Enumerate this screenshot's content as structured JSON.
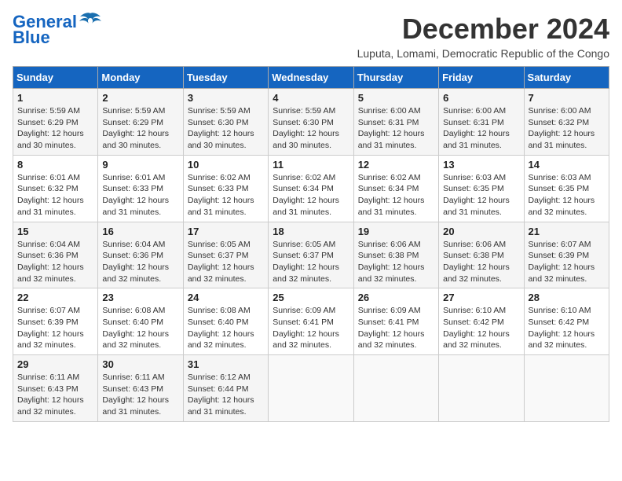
{
  "logo": {
    "line1": "General",
    "line2": "Blue"
  },
  "title": "December 2024",
  "subtitle": "Luputa, Lomami, Democratic Republic of the Congo",
  "weekdays": [
    "Sunday",
    "Monday",
    "Tuesday",
    "Wednesday",
    "Thursday",
    "Friday",
    "Saturday"
  ],
  "weeks": [
    [
      {
        "day": "1",
        "sunrise": "5:59 AM",
        "sunset": "6:29 PM",
        "daylight": "12 hours and 30 minutes."
      },
      {
        "day": "2",
        "sunrise": "5:59 AM",
        "sunset": "6:29 PM",
        "daylight": "12 hours and 30 minutes."
      },
      {
        "day": "3",
        "sunrise": "5:59 AM",
        "sunset": "6:30 PM",
        "daylight": "12 hours and 30 minutes."
      },
      {
        "day": "4",
        "sunrise": "5:59 AM",
        "sunset": "6:30 PM",
        "daylight": "12 hours and 30 minutes."
      },
      {
        "day": "5",
        "sunrise": "6:00 AM",
        "sunset": "6:31 PM",
        "daylight": "12 hours and 31 minutes."
      },
      {
        "day": "6",
        "sunrise": "6:00 AM",
        "sunset": "6:31 PM",
        "daylight": "12 hours and 31 minutes."
      },
      {
        "day": "7",
        "sunrise": "6:00 AM",
        "sunset": "6:32 PM",
        "daylight": "12 hours and 31 minutes."
      }
    ],
    [
      {
        "day": "8",
        "sunrise": "6:01 AM",
        "sunset": "6:32 PM",
        "daylight": "12 hours and 31 minutes."
      },
      {
        "day": "9",
        "sunrise": "6:01 AM",
        "sunset": "6:33 PM",
        "daylight": "12 hours and 31 minutes."
      },
      {
        "day": "10",
        "sunrise": "6:02 AM",
        "sunset": "6:33 PM",
        "daylight": "12 hours and 31 minutes."
      },
      {
        "day": "11",
        "sunrise": "6:02 AM",
        "sunset": "6:34 PM",
        "daylight": "12 hours and 31 minutes."
      },
      {
        "day": "12",
        "sunrise": "6:02 AM",
        "sunset": "6:34 PM",
        "daylight": "12 hours and 31 minutes."
      },
      {
        "day": "13",
        "sunrise": "6:03 AM",
        "sunset": "6:35 PM",
        "daylight": "12 hours and 31 minutes."
      },
      {
        "day": "14",
        "sunrise": "6:03 AM",
        "sunset": "6:35 PM",
        "daylight": "12 hours and 32 minutes."
      }
    ],
    [
      {
        "day": "15",
        "sunrise": "6:04 AM",
        "sunset": "6:36 PM",
        "daylight": "12 hours and 32 minutes."
      },
      {
        "day": "16",
        "sunrise": "6:04 AM",
        "sunset": "6:36 PM",
        "daylight": "12 hours and 32 minutes."
      },
      {
        "day": "17",
        "sunrise": "6:05 AM",
        "sunset": "6:37 PM",
        "daylight": "12 hours and 32 minutes."
      },
      {
        "day": "18",
        "sunrise": "6:05 AM",
        "sunset": "6:37 PM",
        "daylight": "12 hours and 32 minutes."
      },
      {
        "day": "19",
        "sunrise": "6:06 AM",
        "sunset": "6:38 PM",
        "daylight": "12 hours and 32 minutes."
      },
      {
        "day": "20",
        "sunrise": "6:06 AM",
        "sunset": "6:38 PM",
        "daylight": "12 hours and 32 minutes."
      },
      {
        "day": "21",
        "sunrise": "6:07 AM",
        "sunset": "6:39 PM",
        "daylight": "12 hours and 32 minutes."
      }
    ],
    [
      {
        "day": "22",
        "sunrise": "6:07 AM",
        "sunset": "6:39 PM",
        "daylight": "12 hours and 32 minutes."
      },
      {
        "day": "23",
        "sunrise": "6:08 AM",
        "sunset": "6:40 PM",
        "daylight": "12 hours and 32 minutes."
      },
      {
        "day": "24",
        "sunrise": "6:08 AM",
        "sunset": "6:40 PM",
        "daylight": "12 hours and 32 minutes."
      },
      {
        "day": "25",
        "sunrise": "6:09 AM",
        "sunset": "6:41 PM",
        "daylight": "12 hours and 32 minutes."
      },
      {
        "day": "26",
        "sunrise": "6:09 AM",
        "sunset": "6:41 PM",
        "daylight": "12 hours and 32 minutes."
      },
      {
        "day": "27",
        "sunrise": "6:10 AM",
        "sunset": "6:42 PM",
        "daylight": "12 hours and 32 minutes."
      },
      {
        "day": "28",
        "sunrise": "6:10 AM",
        "sunset": "6:42 PM",
        "daylight": "12 hours and 32 minutes."
      }
    ],
    [
      {
        "day": "29",
        "sunrise": "6:11 AM",
        "sunset": "6:43 PM",
        "daylight": "12 hours and 32 minutes."
      },
      {
        "day": "30",
        "sunrise": "6:11 AM",
        "sunset": "6:43 PM",
        "daylight": "12 hours and 31 minutes."
      },
      {
        "day": "31",
        "sunrise": "6:12 AM",
        "sunset": "6:44 PM",
        "daylight": "12 hours and 31 minutes."
      },
      null,
      null,
      null,
      null
    ]
  ],
  "labels": {
    "sunrise": "Sunrise:",
    "sunset": "Sunset:",
    "daylight": "Daylight:"
  }
}
